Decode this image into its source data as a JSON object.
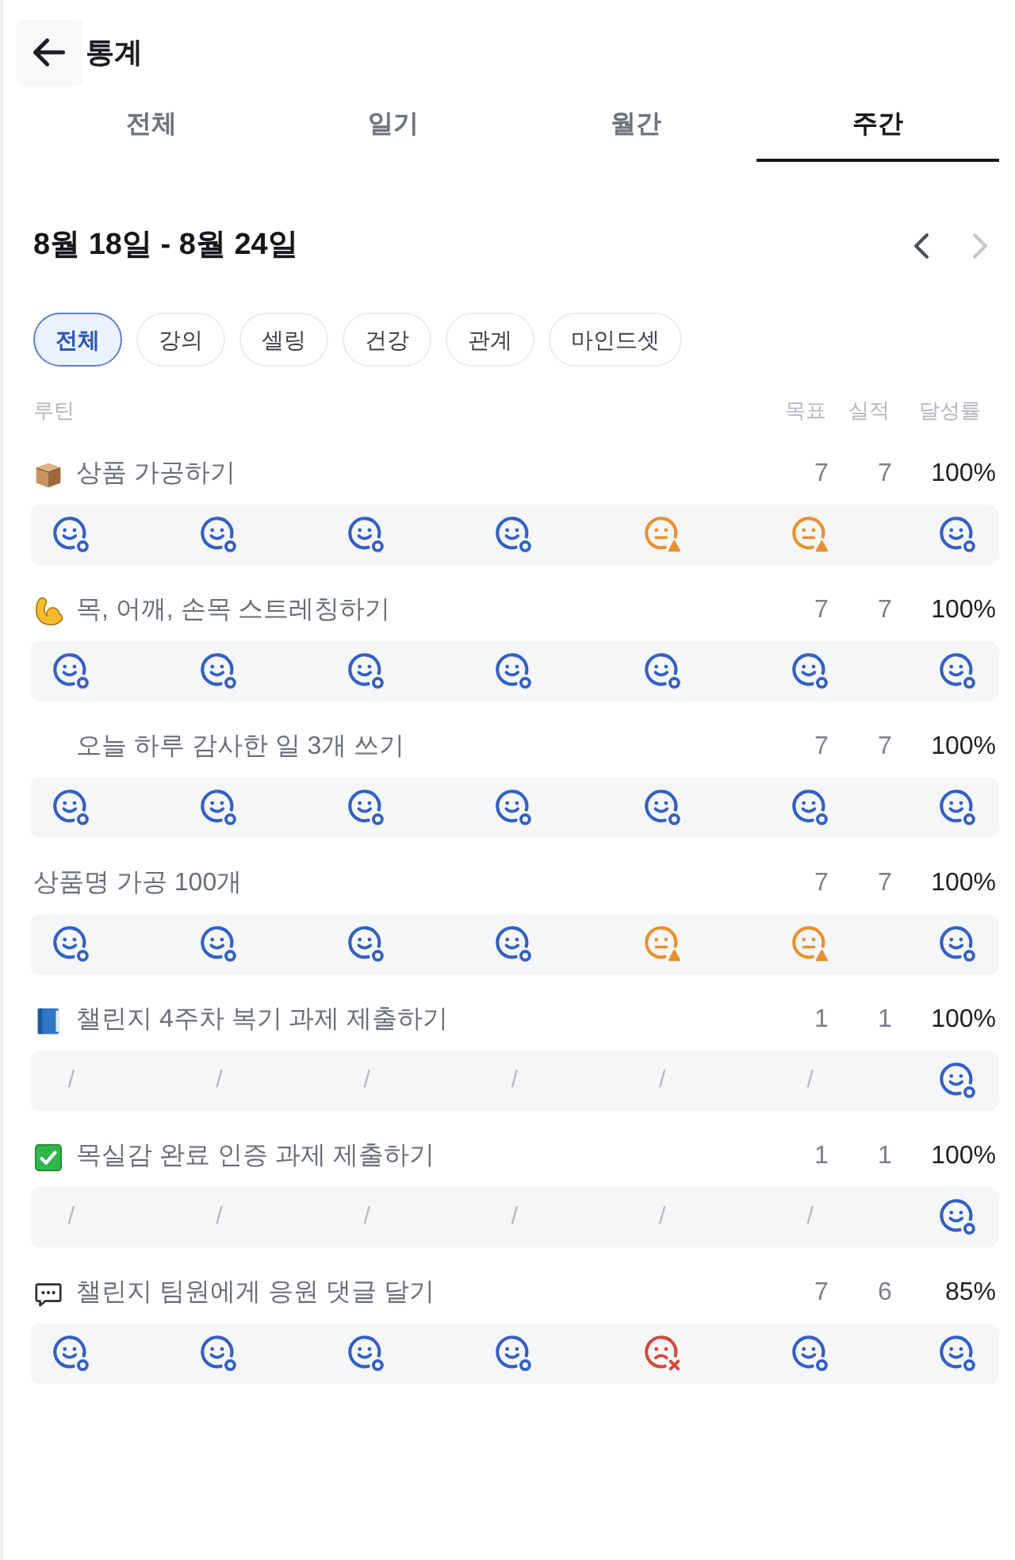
{
  "header": {
    "title": "통계"
  },
  "tabs": [
    {
      "label": "전체",
      "selected": false
    },
    {
      "label": "일기",
      "selected": false
    },
    {
      "label": "월간",
      "selected": false
    },
    {
      "label": "주간",
      "selected": true
    }
  ],
  "week": {
    "range": "8월 18일 - 8월 24일",
    "previous": {
      "disabled": false
    },
    "next": {
      "disabled": true
    }
  },
  "categories": [
    {
      "label": "전체",
      "selected": true
    },
    {
      "label": "강의",
      "selected": false
    },
    {
      "label": "셀링",
      "selected": false
    },
    {
      "label": "건강",
      "selected": false
    },
    {
      "label": "관계",
      "selected": false
    },
    {
      "label": "마인드셋",
      "selected": false
    }
  ],
  "columns": {
    "routine": "루틴",
    "goal": "목표",
    "actual": "실적",
    "rate": "달성률"
  },
  "routines": [
    {
      "kind": "box",
      "title": "상품 가공하기",
      "goal": "7",
      "actual": "7",
      "rate": "100%",
      "days": [
        {
          "kind": "done"
        },
        {
          "kind": "done"
        },
        {
          "kind": "done"
        },
        {
          "kind": "done"
        },
        {
          "kind": "late"
        },
        {
          "kind": "late"
        },
        {
          "kind": "done"
        }
      ]
    },
    {
      "kind": "muscle",
      "title": "목, 어깨, 손목 스트레칭하기",
      "goal": "7",
      "actual": "7",
      "rate": "100%",
      "days": [
        {
          "kind": "done"
        },
        {
          "kind": "done"
        },
        {
          "kind": "done"
        },
        {
          "kind": "done"
        },
        {
          "kind": "done"
        },
        {
          "kind": "done"
        },
        {
          "kind": "done"
        }
      ]
    },
    {
      "kind": "indented",
      "title": "오늘 하루 감사한 일 3개 쓰기",
      "goal": "7",
      "actual": "7",
      "rate": "100%",
      "days": [
        {
          "kind": "done"
        },
        {
          "kind": "done"
        },
        {
          "kind": "done"
        },
        {
          "kind": "done"
        },
        {
          "kind": "done"
        },
        {
          "kind": "done"
        },
        {
          "kind": "done"
        }
      ]
    },
    {
      "kind": "plain",
      "title": "상품명 가공 100개",
      "goal": "7",
      "actual": "7",
      "rate": "100%",
      "days": [
        {
          "kind": "done"
        },
        {
          "kind": "done"
        },
        {
          "kind": "done"
        },
        {
          "kind": "done"
        },
        {
          "kind": "late"
        },
        {
          "kind": "late"
        },
        {
          "kind": "done"
        }
      ]
    },
    {
      "kind": "book",
      "title": "챌린지 4주차 복기 과제 제출하기",
      "goal": "1",
      "actual": "1",
      "rate": "100%",
      "days": [
        {
          "kind": "none",
          "text": "/"
        },
        {
          "kind": "none",
          "text": "/"
        },
        {
          "kind": "none",
          "text": "/"
        },
        {
          "kind": "none",
          "text": "/"
        },
        {
          "kind": "none",
          "text": "/"
        },
        {
          "kind": "none",
          "text": "/"
        },
        {
          "kind": "done"
        }
      ]
    },
    {
      "kind": "check",
      "title": "목실감 완료 인증 과제 제출하기",
      "goal": "1",
      "actual": "1",
      "rate": "100%",
      "days": [
        {
          "kind": "none",
          "text": "/"
        },
        {
          "kind": "none",
          "text": "/"
        },
        {
          "kind": "none",
          "text": "/"
        },
        {
          "kind": "none",
          "text": "/"
        },
        {
          "kind": "none",
          "text": "/"
        },
        {
          "kind": "none",
          "text": "/"
        },
        {
          "kind": "done"
        }
      ]
    },
    {
      "kind": "speech",
      "title": "챌린지 팀원에게 응원 댓글 달기",
      "goal": "7",
      "actual": "6",
      "rate": "85%",
      "days": [
        {
          "kind": "done"
        },
        {
          "kind": "done"
        },
        {
          "kind": "done"
        },
        {
          "kind": "done"
        },
        {
          "kind": "missed"
        },
        {
          "kind": "done"
        },
        {
          "kind": "done"
        }
      ]
    }
  ]
}
